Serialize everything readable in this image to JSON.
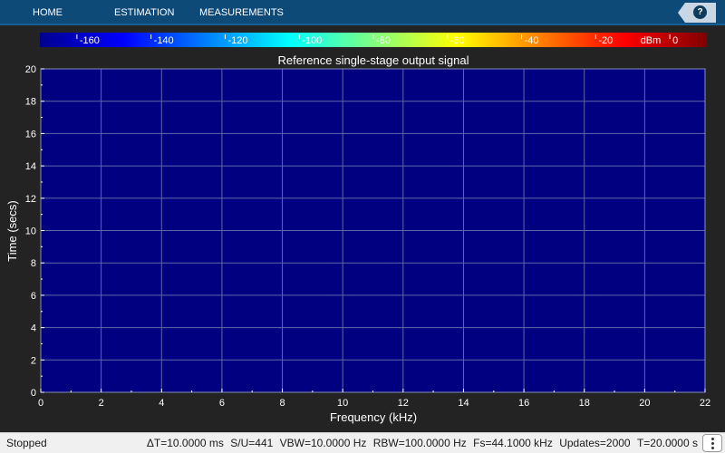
{
  "toolstrip": {
    "tabs": [
      "HOME",
      "ESTIMATION",
      "MEASUREMENTS"
    ],
    "help_label": "?"
  },
  "colorbar": {
    "ticks": [
      "-160",
      "-140",
      "-120",
      "-100",
      "-80",
      "-60",
      "-40",
      "-20",
      "0"
    ],
    "unit": "dBm",
    "range": [
      -170,
      10
    ],
    "colormap": "jet"
  },
  "chart_data": {
    "type": "heatmap",
    "title": "Reference single-stage output signal",
    "xlabel": "Frequency (kHz)",
    "ylabel": "Time (secs)",
    "x_ticks": [
      "0",
      "2",
      "4",
      "6",
      "8",
      "10",
      "12",
      "14",
      "16",
      "18",
      "20",
      "22"
    ],
    "y_ticks": [
      "0",
      "2",
      "4",
      "6",
      "8",
      "10",
      "12",
      "14",
      "16",
      "18",
      "20"
    ],
    "xlim": [
      0,
      22
    ],
    "ylim": [
      0,
      20
    ],
    "grid": true,
    "fill_color": "#000080",
    "grid_color": "#5b6aa8"
  },
  "status": {
    "state": "Stopped",
    "delta_t": "ΔT=10.0000 ms",
    "samples_per_update": "S/U=441",
    "vbw": "VBW=10.0000 Hz",
    "rbw": "RBW=100.0000 Hz",
    "fs": "Fs=44.1000 kHz",
    "updates": "Updates=2000",
    "t": "T=20.0000 s"
  }
}
